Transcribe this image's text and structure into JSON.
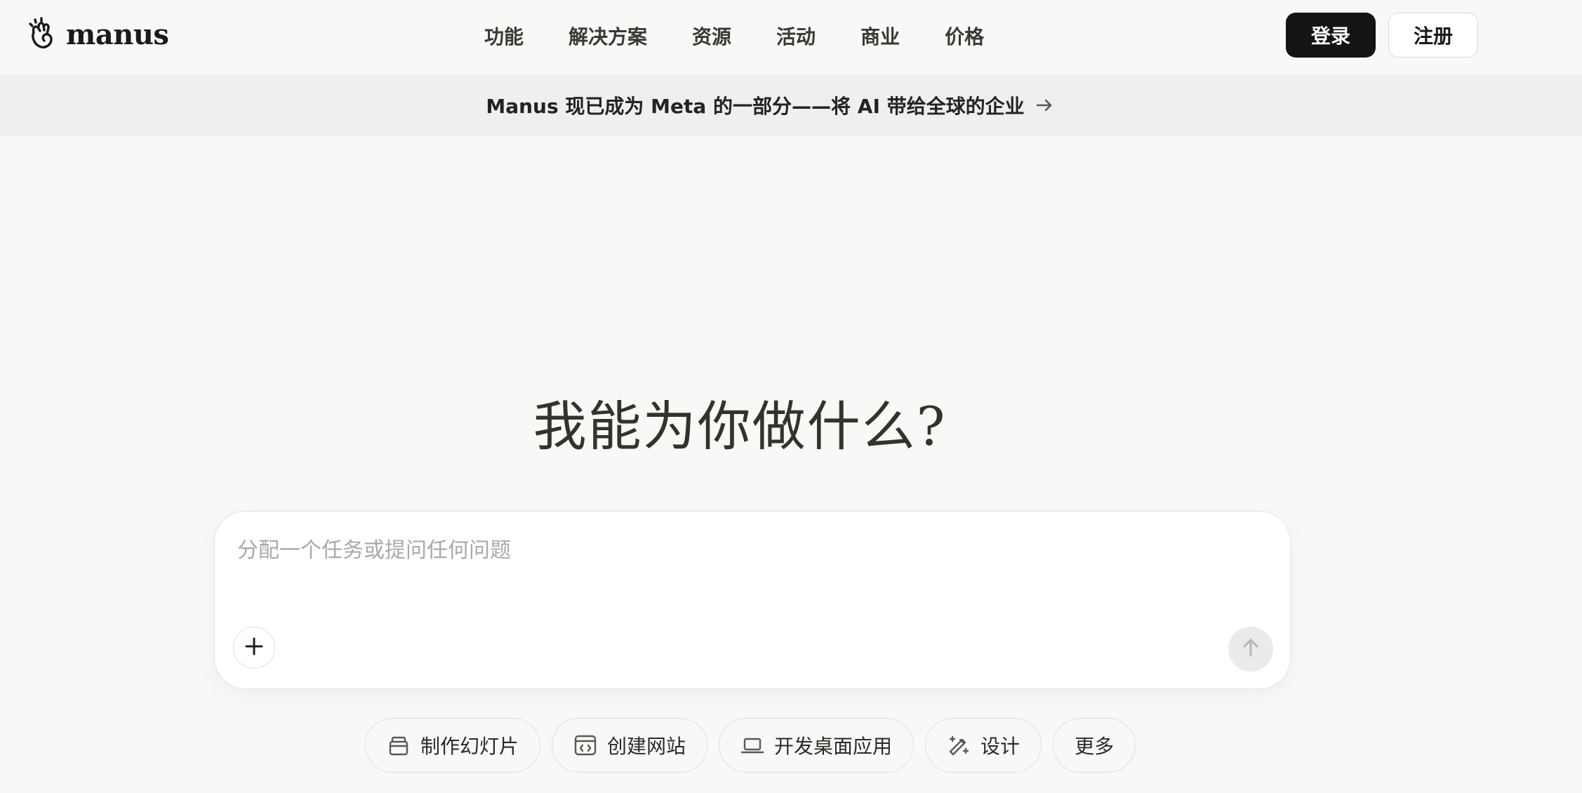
{
  "brand": {
    "name": "manus",
    "logo_icon": "manus-hand-icon"
  },
  "nav": {
    "items": [
      {
        "label": "功能"
      },
      {
        "label": "解决方案"
      },
      {
        "label": "资源"
      },
      {
        "label": "活动"
      },
      {
        "label": "商业"
      },
      {
        "label": "价格"
      }
    ]
  },
  "auth": {
    "login_label": "登录",
    "signup_label": "注册"
  },
  "banner": {
    "text": "Manus 现已成为 Meta 的一部分——将 AI 带给全球的企业",
    "icon": "arrow-right-icon"
  },
  "hero": {
    "title": "我能为你做什么?"
  },
  "composer": {
    "placeholder": "分配一个任务或提问任何问题",
    "value": "",
    "attach_icon": "plus-icon",
    "send_icon": "arrow-up-icon"
  },
  "quick_actions": [
    {
      "label": "制作幻灯片",
      "icon": "slides-icon"
    },
    {
      "label": "创建网站",
      "icon": "code-window-icon"
    },
    {
      "label": "开发桌面应用",
      "icon": "laptop-icon"
    },
    {
      "label": "设计",
      "icon": "magic-pen-icon"
    },
    {
      "label": "更多",
      "icon": ""
    }
  ],
  "colors": {
    "page_bg": "#f8f8f7",
    "banner_bg": "#efefee",
    "primary_button": "#141414",
    "text": "#34322d",
    "placeholder": "#a9a9a6"
  }
}
